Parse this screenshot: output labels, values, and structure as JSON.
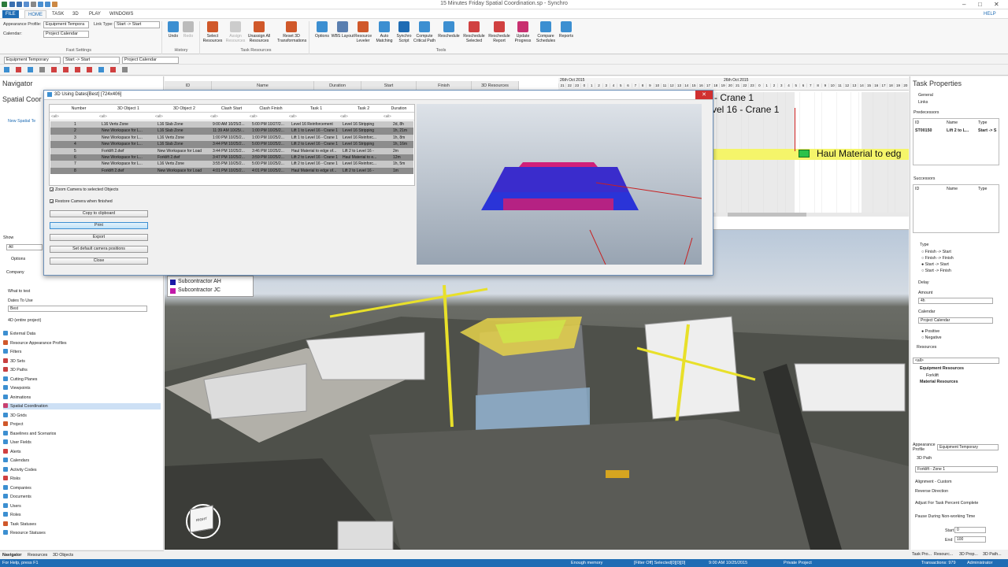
{
  "window": {
    "title": "15 Minutes Friday Spatial Coordination.sp - Synchro",
    "help": "HELP"
  },
  "ribbon": {
    "tabs": [
      "FILE",
      "HOME",
      "TASK",
      "3D",
      "PLAY",
      "WINDOWS"
    ],
    "appearance_profile_label": "Appearance Profile:",
    "appearance_profile_value": "Equipment Tempora",
    "calendar_label": "Calendar:",
    "calendar_value": "Project Calendar",
    "link_type_label": "Link Type:",
    "link_type_value": "Start -> Start",
    "fast_settings_label": "Fast Settings",
    "history_label": "History",
    "task_resources_label": "Task Resources",
    "tools_label": "Tools",
    "buttons": {
      "undo": "Undo",
      "redo": "Redo",
      "select_resources": "Select Resources",
      "assign_resources": "Assign Resources",
      "unassign_all": "Unassign All Resources",
      "reset_3d": "Reset 3D Transformations",
      "options": "Options",
      "wbs_layout": "WBS Layout",
      "resource_leveler": "Resource Leveler",
      "auto_matching": "Auto Matching",
      "synchro_script": "Synchro Script",
      "compute_critical": "Compute Critical Path",
      "reschedule": "Reschedule",
      "reschedule_selected": "Reschedule Selected",
      "reschedule_report": "Reschedule Report",
      "update_progress": "Update Progress",
      "compare_schedules": "Compare Schedules",
      "reports": "Reports"
    }
  },
  "toolbar": {
    "profile": "Equipment Temporary",
    "link": "Start -> Start",
    "calendar": "Project Calendar"
  },
  "navigator": {
    "title": "Navigator",
    "spatial_title": "Spatial Coor",
    "tree_item": "New Spatial Te",
    "show_label": "Show",
    "show_value": "All",
    "options_label": "Options",
    "company_label": "Company",
    "what_to_test": "What to test",
    "dates_label": "Dates To Use",
    "dates_value": "Best",
    "mode_4d": "4D (entire project)",
    "items": [
      "External Data",
      "Resource Appearance Profiles",
      "Filters",
      "3D Sets",
      "3D Paths",
      "Cutting Planes",
      "Viewpoints",
      "Animations",
      "Spatial Coordination",
      "3D Grids",
      "Project",
      "Baselines and Scenarios",
      "User Fields",
      "Alerts",
      "Calendars",
      "Activity Codes",
      "Risks",
      "Companies",
      "Documents",
      "Users",
      "Roles",
      "Task Statuses",
      "Resource Statuses"
    ],
    "selected": "Spatial Coordination",
    "bottom_tabs": [
      "Navigator",
      "Resources",
      "3D Objects"
    ]
  },
  "gantt": {
    "columns": [
      "ID",
      "Name",
      "Duration",
      "Start",
      "Finish",
      "3D Resources"
    ],
    "date_left": "26th Oct 2015",
    "date_right": "26th Oct 2015",
    "hours": [
      "21",
      "22",
      "23",
      "0",
      "1",
      "2",
      "3",
      "4",
      "5",
      "6",
      "7",
      "8",
      "9",
      "10",
      "11",
      "12",
      "13",
      "14",
      "15",
      "16",
      "17",
      "18",
      "19",
      "20",
      "21",
      "22",
      "23",
      "0",
      "1",
      "2",
      "3",
      "4",
      "5",
      "6",
      "7",
      "8",
      "9",
      "10",
      "11",
      "12",
      "13",
      "14",
      "15",
      "16",
      "17",
      "18",
      "19",
      "20"
    ],
    "bar_labels": [
      "- Crane 1",
      "vel 16 - Crane 1",
      "Haul Material to edg"
    ]
  },
  "dialog": {
    "title": "3D Using Dates[Best] [724x406]",
    "headers": [
      "Number",
      "3D Object 1",
      "3D Object 2",
      "Clash Start",
      "Clash Finish",
      "Task 1",
      "Task 2",
      "Duration"
    ],
    "filter_placeholder": "<all>",
    "rows": [
      {
        "n": "1",
        "o1": "L16 Verts Zone",
        "o2": "L16 Slab Zone",
        "cs": "9:00 AM 10/25/2...",
        "cf": "5:00 PM 10/27/2...",
        "t1": "Level 16 Reinforcement",
        "t2": "Level 16 Stripping",
        "d": "2d, 8h"
      },
      {
        "n": "2",
        "o1": "New Workspace for L...",
        "o2": "L16 Slab Zone",
        "cs": "11:39 AM 10/25/...",
        "cf": "1:00 PM 10/25/2...",
        "t1": "Lift 1 to Level 16 - Crane 1",
        "t2": "Level 16 Stripping",
        "d": "1h, 21m"
      },
      {
        "n": "3",
        "o1": "New Workspace for L...",
        "o2": "L16 Verts Zone",
        "cs": "1:00 PM 10/25/2...",
        "cf": "1:00 PM 10/25/2...",
        "t1": "Lift 1 to Level 16 - Crane 1",
        "t2": "Level 16 Reinforc...",
        "d": "1h, 8m"
      },
      {
        "n": "4",
        "o1": "New Workspace for L...",
        "o2": "L16 Slab Zone",
        "cs": "3:44 PM 10/25/2...",
        "cf": "5:00 PM 10/25/2...",
        "t1": "Lift 2 to Level 16 - Crane 1",
        "t2": "Level 16 Stripping",
        "d": "1h, 16m"
      },
      {
        "n": "5",
        "o1": "Forklift 2.dwf",
        "o2": "New Workspace for Load",
        "cs": "3:44 PM 10/25/2...",
        "cf": "3:46 PM 10/25/2...",
        "t1": "Haul Material to edge of...",
        "t2": "Lift 2 to Level 16 -",
        "d": "2m"
      },
      {
        "n": "6",
        "o1": "New Workspace for L...",
        "o2": "Forklift 2.dwf",
        "cs": "3:47 PM 10/25/2...",
        "cf": "3:59 PM 10/25/2...",
        "t1": "Lift 2 to Level 16 - Crane 1",
        "t2": "Haul Material to e...",
        "d": "12m"
      },
      {
        "n": "7",
        "o1": "New Workspace for L...",
        "o2": "L16 Verts Zone",
        "cs": "3:55 PM 10/25/2...",
        "cf": "5:00 PM 10/25/2...",
        "t1": "Lift 2 to Level 16 - Crane 1",
        "t2": "Level 16 Reinforc...",
        "d": "1h, 5m"
      },
      {
        "n": "8",
        "o1": "Forklift 2.dwf",
        "o2": "New Workspace for Load",
        "cs": "4:01 PM 10/25/2...",
        "cf": "4:01 PM 10/25/2...",
        "t1": "Haul Material to edge of...",
        "t2": "Lift 2 to Level 16 -",
        "d": "1m"
      }
    ],
    "zoom_camera": "Zoom Camera to selected Objects",
    "restore_camera": "Restore Camera when finished",
    "btn_copy": "Copy to clipboard",
    "btn_print": "Print",
    "btn_export": "Export",
    "btn_default": "Set default camera positions",
    "btn_close": "Close"
  },
  "legend": {
    "items": [
      "Subcontractor AH",
      "Subcontractor JC"
    ],
    "colors": [
      "#1a1aa8",
      "#c21aa8"
    ]
  },
  "props": {
    "title": "Task Properties",
    "general": "General",
    "links": "Links",
    "predecessors": "Predecessors",
    "pred_cols": [
      "ID",
      "Name",
      "Type"
    ],
    "pred_row": {
      "id": "ST00150",
      "name": "Lift 2 to L...",
      "type": "Start -> S"
    },
    "successors": "Successors",
    "type_label": "Type",
    "types": [
      "Finish -> Start",
      "Finish -> Finish",
      "Start -> Start",
      "Start -> Finish"
    ],
    "selected_type": "Start -> Start",
    "delay": "Delay",
    "amount_label": "Amount",
    "amount_value": "4h",
    "calendar_label": "Calendar",
    "calendar_value": "Project Calendar",
    "positive": "Positive",
    "negative": "Negative",
    "resources": "Resources",
    "filter": "<all>",
    "res_equipment": "Equipment Resources",
    "res_forklift": "Forklift",
    "res_material": "Material Resources",
    "appearance_label": "Appearance Profile",
    "appearance_value": "Equipment Temporary",
    "path_label": "3D Path",
    "path_value": "Forklift - Zone 1",
    "alignment": "Alignment - Custom",
    "reverse": "Reverse Direction",
    "adjust": "Adjust For Task Percent Complete",
    "pause": "Pause During Non-working Time",
    "start_label": "Start",
    "start_value": "0",
    "end_label": "End",
    "end_value": "100",
    "bottom_tabs": [
      "Task Pro...",
      "Resourc...",
      "3D Prop...",
      "3D Path..."
    ]
  },
  "status": {
    "help": "For Help, press F1",
    "memory": "Enough memory",
    "filter": "[Filter Off]  Selected[0][0][0]",
    "datetime": "9:00 AM 10/25/2015",
    "project": "Private Project",
    "transactions": "Transactions: 979",
    "user": "Administrator"
  },
  "viewcube": {
    "front": "RIGHT",
    "side": "BACK"
  }
}
